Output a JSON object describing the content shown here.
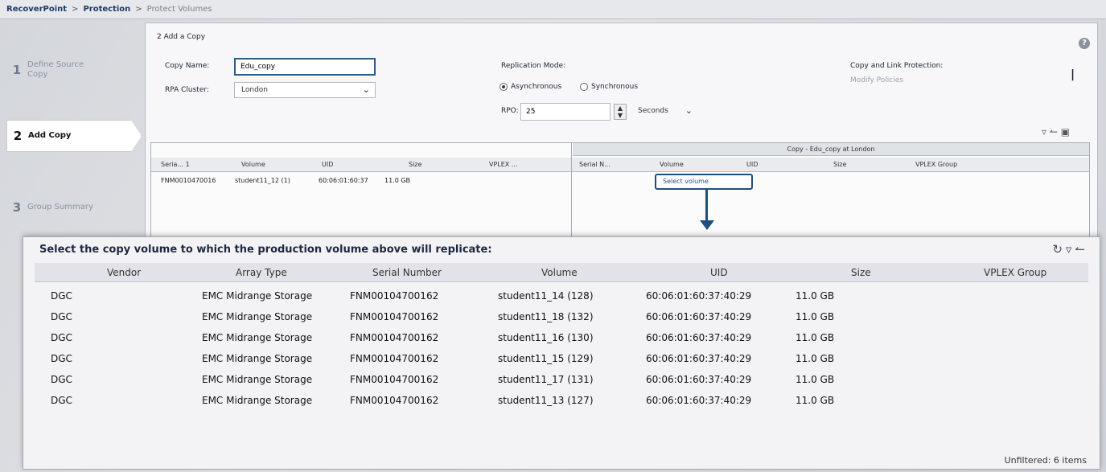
{
  "breadcrumb": [
    "RecoverPoint",
    "Protection",
    "Protect Volumes"
  ],
  "steps": [
    {
      "num": "1",
      "label": "Define Source\nCopy"
    },
    {
      "num": "2",
      "label": "Add Copy"
    },
    {
      "num": "3",
      "label": "Group Summary"
    }
  ],
  "form": {
    "section_title": "2  Add a Copy",
    "copy_name_label": "Copy Name:",
    "copy_name_value": "Edu_copy",
    "rpa_cluster_label": "RPA Cluster:",
    "rpa_cluster_value": "London",
    "replication_mode_label": "Replication Mode:",
    "async_label": "Asynchronous",
    "sync_label": "Synchronous",
    "rpo_label": "RPO:",
    "rpo_value": "25",
    "rpo_unit": "Seconds",
    "link_protection_label": "Copy and Link Protection:",
    "link_protection_value": "Modify Policies"
  },
  "rep_table": {
    "copy_group_header": "Copy - Edu_copy at London",
    "left_headers": [
      "Seria... 1",
      "Volume",
      "UID",
      "Size",
      "VPLEX ..."
    ],
    "right_headers": [
      "Serial N...",
      "Volume",
      "UID",
      "Size",
      "VPLEX Group"
    ],
    "row": {
      "serial": "FNM0010470016",
      "volume": "student11_12 (1)",
      "uid": "60:06:01:60:37",
      "size": "11.0 GB"
    },
    "select_volume": "Select volume"
  },
  "popup": {
    "title": "Select the copy volume to which the production volume above will replicate:",
    "headers": [
      "Vendor",
      "Array Type",
      "Serial Number",
      "Volume",
      "UID",
      "Size",
      "VPLEX Group"
    ],
    "rows": [
      {
        "vendor": "DGC",
        "array": "EMC Midrange Storage",
        "serial": "FNM00104700162",
        "volume": "student11_14 (128)",
        "uid": "60:06:01:60:37:40:29",
        "size": "11.0 GB"
      },
      {
        "vendor": "DGC",
        "array": "EMC Midrange Storage",
        "serial": "FNM00104700162",
        "volume": "student11_18 (132)",
        "uid": "60:06:01:60:37:40:29",
        "size": "11.0 GB"
      },
      {
        "vendor": "DGC",
        "array": "EMC Midrange Storage",
        "serial": "FNM00104700162",
        "volume": "student11_16 (130)",
        "uid": "60:06:01:60:37:40:29",
        "size": "11.0 GB"
      },
      {
        "vendor": "DGC",
        "array": "EMC Midrange Storage",
        "serial": "FNM00104700162",
        "volume": "student11_15 (129)",
        "uid": "60:06:01:60:37:40:29",
        "size": "11.0 GB"
      },
      {
        "vendor": "DGC",
        "array": "EMC Midrange Storage",
        "serial": "FNM00104700162",
        "volume": "student11_17 (131)",
        "uid": "60:06:01:60:37:40:29",
        "size": "11.0 GB"
      },
      {
        "vendor": "DGC",
        "array": "EMC Midrange Storage",
        "serial": "FNM00104700162",
        "volume": "student11_13 (127)",
        "uid": "60:06:01:60:37:40:29",
        "size": "11.0 GB"
      }
    ],
    "footer": "Unfiltered: 6 items"
  }
}
